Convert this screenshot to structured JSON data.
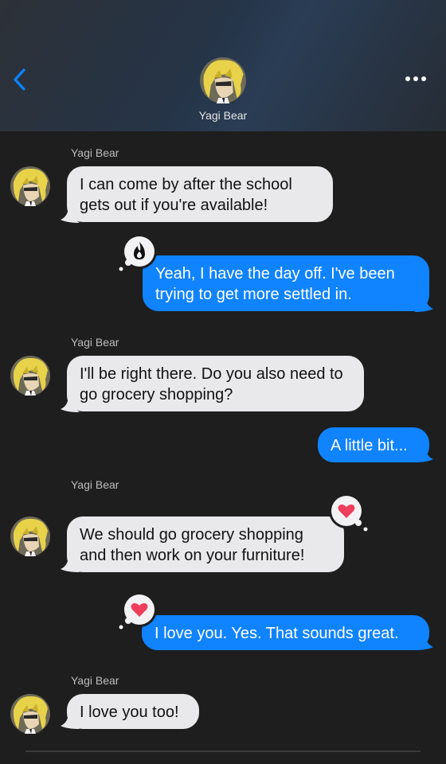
{
  "contact": {
    "name": "Yagi Bear"
  },
  "messages": [
    {
      "from": "them",
      "sender": "Yagi Bear",
      "text": "I can come by after the school gets out if you're available!"
    },
    {
      "from": "me",
      "text": "Yeah, I have the day off. I've been trying to get more settled in.",
      "tapback": "fire-icon"
    },
    {
      "from": "them",
      "sender": "Yagi Bear",
      "text": "I'll be right there. Do you also need to go grocery shopping?"
    },
    {
      "from": "me",
      "text": "A little bit..."
    },
    {
      "from": "them",
      "sender": "Yagi Bear",
      "text": "We should go grocery shopping and then work on your furniture!",
      "tapback": "heart-icon"
    },
    {
      "from": "me",
      "text": "I love you. Yes. That sounds great.",
      "tapback": "heart-icon"
    },
    {
      "from": "them",
      "sender": "Yagi Bear",
      "text": "I love you too!"
    }
  ],
  "colors": {
    "outgoing": "#1083fe",
    "incoming": "#e9e9eb",
    "accent": "#0a84ff",
    "heart": "#ef3e5c"
  }
}
